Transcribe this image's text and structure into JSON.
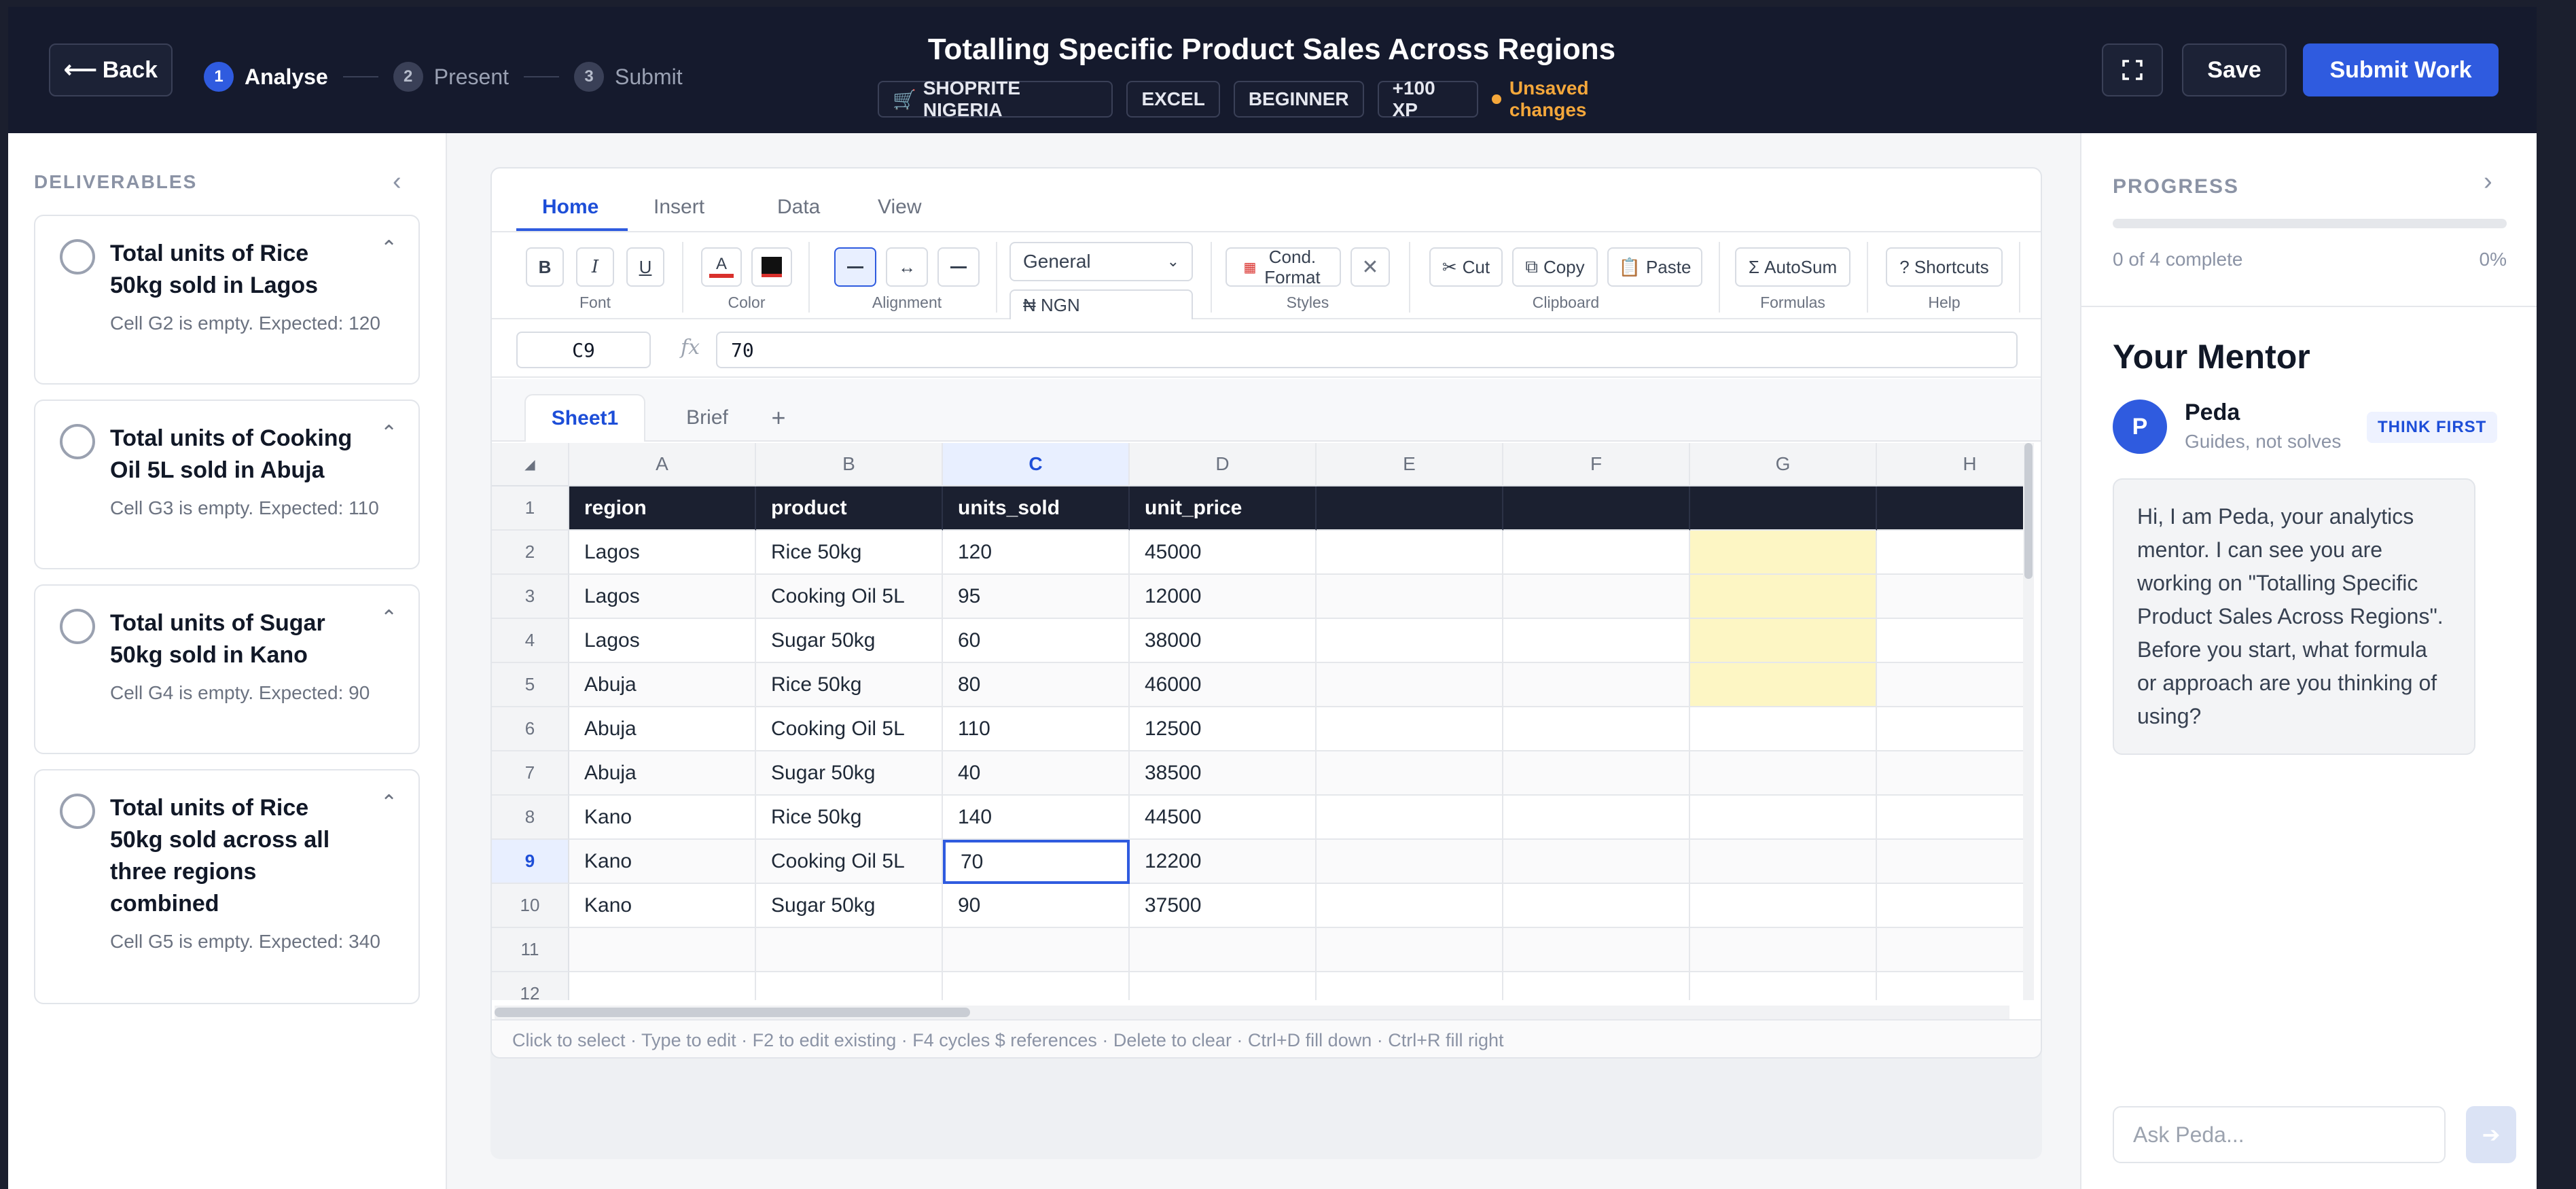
{
  "header": {
    "back_label": "Back",
    "steps": [
      {
        "num": "1",
        "label": "Analyse"
      },
      {
        "num": "2",
        "label": "Present"
      },
      {
        "num": "3",
        "label": "Submit"
      }
    ],
    "title": "Totalling Specific Product Sales Across Regions",
    "tags": [
      "SHOPRITE NIGERIA",
      "EXCEL",
      "BEGINNER",
      "+100 XP"
    ],
    "unsaved_label": "Unsaved changes",
    "save_label": "Save",
    "submit_label": "Submit Work"
  },
  "deliverables": {
    "heading": "DELIVERABLES",
    "items": [
      {
        "title": "Total units of Rice 50kg sold in Lagos",
        "desc": "Cell G2 is empty. Expected: 120"
      },
      {
        "title": "Total units of Cooking Oil 5L sold in Abuja",
        "desc": "Cell G3 is empty. Expected: 110"
      },
      {
        "title": "Total units of Sugar 50kg sold in Kano",
        "desc": "Cell G4 is empty. Expected: 90"
      },
      {
        "title": "Total units of Rice 50kg sold across all three regions combined",
        "desc": "Cell G5 is empty. Expected: 340"
      }
    ]
  },
  "ribbon": {
    "tabs": [
      "Home",
      "Insert",
      "Data",
      "View"
    ],
    "groups": {
      "font": "Font",
      "color": "Color",
      "alignment": "Alignment",
      "styles": "Styles",
      "clipboard": "Clipboard",
      "formulas": "Formulas",
      "help": "Help"
    },
    "bold": "B",
    "italic": "I",
    "underline": "U",
    "number_format": "General",
    "currency": "₦ NGN",
    "cond_format": "Cond. Format",
    "cut": "Cut",
    "copy": "Copy",
    "paste": "Paste",
    "autosum": "Σ AutoSum",
    "shortcuts": "? Shortcuts",
    "font_color": "#d9302c",
    "fill_color": "#111111"
  },
  "formula_bar": {
    "cell_ref": "C9",
    "fx": "fx",
    "value": "70"
  },
  "sheets": {
    "tabs": [
      "Sheet1",
      "Brief"
    ],
    "add": "+"
  },
  "grid": {
    "columns": [
      "A",
      "B",
      "C",
      "D",
      "E",
      "F",
      "G",
      "H"
    ],
    "rows": [
      [
        "region",
        "product",
        "units_sold",
        "unit_price",
        "",
        "",
        "",
        ""
      ],
      [
        "Lagos",
        "Rice 50kg",
        "120",
        "45000",
        "",
        "",
        "",
        ""
      ],
      [
        "Lagos",
        "Cooking Oil 5L",
        "95",
        "12000",
        "",
        "",
        "",
        ""
      ],
      [
        "Lagos",
        "Sugar 50kg",
        "60",
        "38000",
        "",
        "",
        "",
        ""
      ],
      [
        "Abuja",
        "Rice 50kg",
        "80",
        "46000",
        "",
        "",
        "",
        ""
      ],
      [
        "Abuja",
        "Cooking Oil 5L",
        "110",
        "12500",
        "",
        "",
        "",
        ""
      ],
      [
        "Abuja",
        "Sugar 50kg",
        "40",
        "38500",
        "",
        "",
        "",
        ""
      ],
      [
        "Kano",
        "Rice 50kg",
        "140",
        "44500",
        "",
        "",
        "",
        ""
      ],
      [
        "Kano",
        "Cooking Oil 5L",
        "70",
        "12200",
        "",
        "",
        "",
        ""
      ],
      [
        "Kano",
        "Sugar 50kg",
        "90",
        "37500",
        "",
        "",
        "",
        ""
      ],
      [
        "",
        "",
        "",
        "",
        "",
        "",
        "",
        ""
      ],
      [
        "",
        "",
        "",
        "",
        "",
        "",
        "",
        ""
      ]
    ],
    "row_numbers": [
      "1",
      "2",
      "3",
      "4",
      "5",
      "6",
      "7",
      "8",
      "9",
      "10",
      "11",
      "12"
    ],
    "selected_cell": "C9",
    "target_cells": [
      "G2",
      "G3",
      "G4",
      "G5"
    ]
  },
  "status_bar": "Click to select · Type to edit · F2 to edit existing · F4 cycles $ references · Delete to clear · Ctrl+D fill down · Ctrl+R fill right",
  "progress": {
    "heading": "PROGRESS",
    "text": "0 of 4 complete",
    "percent_label": "0%",
    "fraction": 0
  },
  "mentor": {
    "heading": "Your Mentor",
    "initial": "P",
    "name": "Peda",
    "subtitle": "Guides, not solves",
    "badge": "THINK FIRST",
    "message": "Hi, I am Peda, your analytics mentor. I can see you are working on \"Totalling Specific Product Sales Across Regions\". Before you start, what formula or approach are you thinking of using?",
    "ask_placeholder": "Ask Peda..."
  }
}
